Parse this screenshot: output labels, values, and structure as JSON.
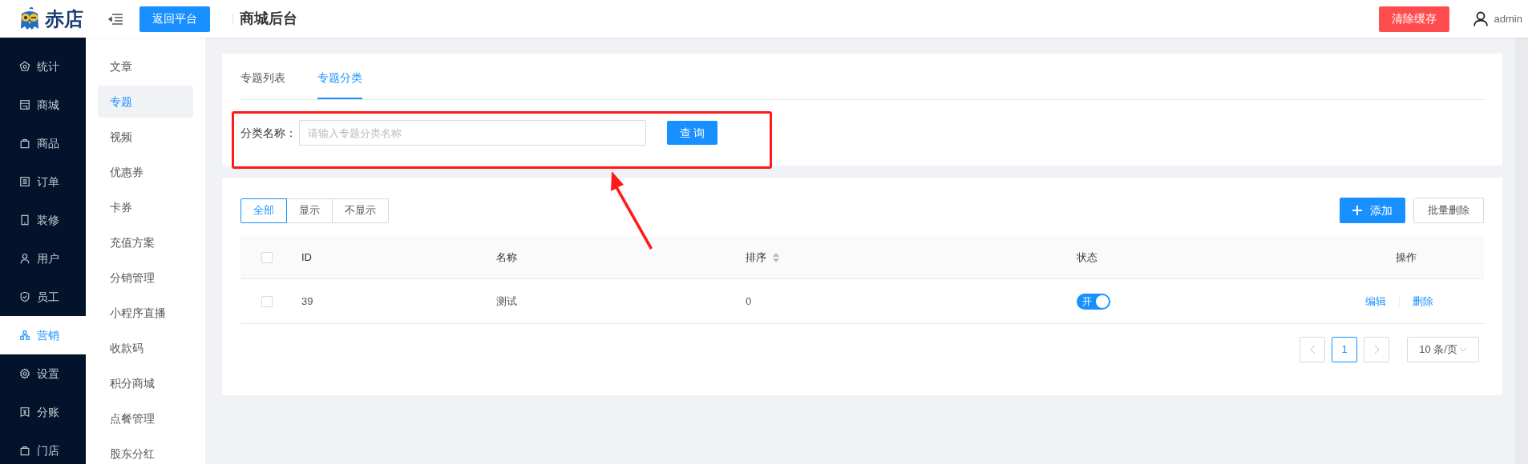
{
  "header": {
    "brand": "赤店",
    "back_button": "返回平台",
    "title": "商城后台",
    "clear_cache_button": "清除缓存",
    "user": "admin"
  },
  "sidebar": {
    "items": [
      {
        "label": "统计",
        "selected": false
      },
      {
        "label": "商城",
        "selected": false
      },
      {
        "label": "商品",
        "selected": false
      },
      {
        "label": "订单",
        "selected": false
      },
      {
        "label": "装修",
        "selected": false
      },
      {
        "label": "用户",
        "selected": false
      },
      {
        "label": "员工",
        "selected": false
      },
      {
        "label": "营销",
        "selected": true
      },
      {
        "label": "设置",
        "selected": false
      },
      {
        "label": "分账",
        "selected": false
      },
      {
        "label": "门店",
        "selected": false
      }
    ]
  },
  "submenu": {
    "items": [
      {
        "label": "文章",
        "selected": false
      },
      {
        "label": "专题",
        "selected": true
      },
      {
        "label": "视频",
        "selected": false
      },
      {
        "label": "优惠券",
        "selected": false
      },
      {
        "label": "卡券",
        "selected": false
      },
      {
        "label": "充值方案",
        "selected": false
      },
      {
        "label": "分销管理",
        "selected": false
      },
      {
        "label": "小程序直播",
        "selected": false
      },
      {
        "label": "收款码",
        "selected": false
      },
      {
        "label": "积分商城",
        "selected": false
      },
      {
        "label": "点餐管理",
        "selected": false
      },
      {
        "label": "股东分红",
        "selected": false
      }
    ]
  },
  "tabs": [
    {
      "label": "专题列表",
      "selected": false
    },
    {
      "label": "专题分类",
      "selected": true
    }
  ],
  "search": {
    "label": "分类名称：",
    "placeholder": "请输入专题分类名称",
    "button": "查 询"
  },
  "filters": [
    {
      "label": "全部",
      "selected": true
    },
    {
      "label": "显示",
      "selected": false
    },
    {
      "label": "不显示",
      "selected": false
    }
  ],
  "actions": {
    "add": "添加",
    "batch_delete": "批量删除"
  },
  "table": {
    "header_checked": false,
    "columns": [
      {
        "label": "ID"
      },
      {
        "label": "名称"
      },
      {
        "label": "排序",
        "sortable": true
      },
      {
        "label": "状态"
      },
      {
        "label": "操作"
      }
    ],
    "rows": [
      {
        "checked": false,
        "id": "39",
        "name": "测试",
        "sort": "0",
        "status": {
          "on": true,
          "label": "开"
        },
        "actions": [
          "编辑",
          "删除"
        ]
      }
    ]
  },
  "pagination": {
    "pages": [
      {
        "label": "1",
        "selected": true
      }
    ],
    "page_size": "10 条/页"
  }
}
